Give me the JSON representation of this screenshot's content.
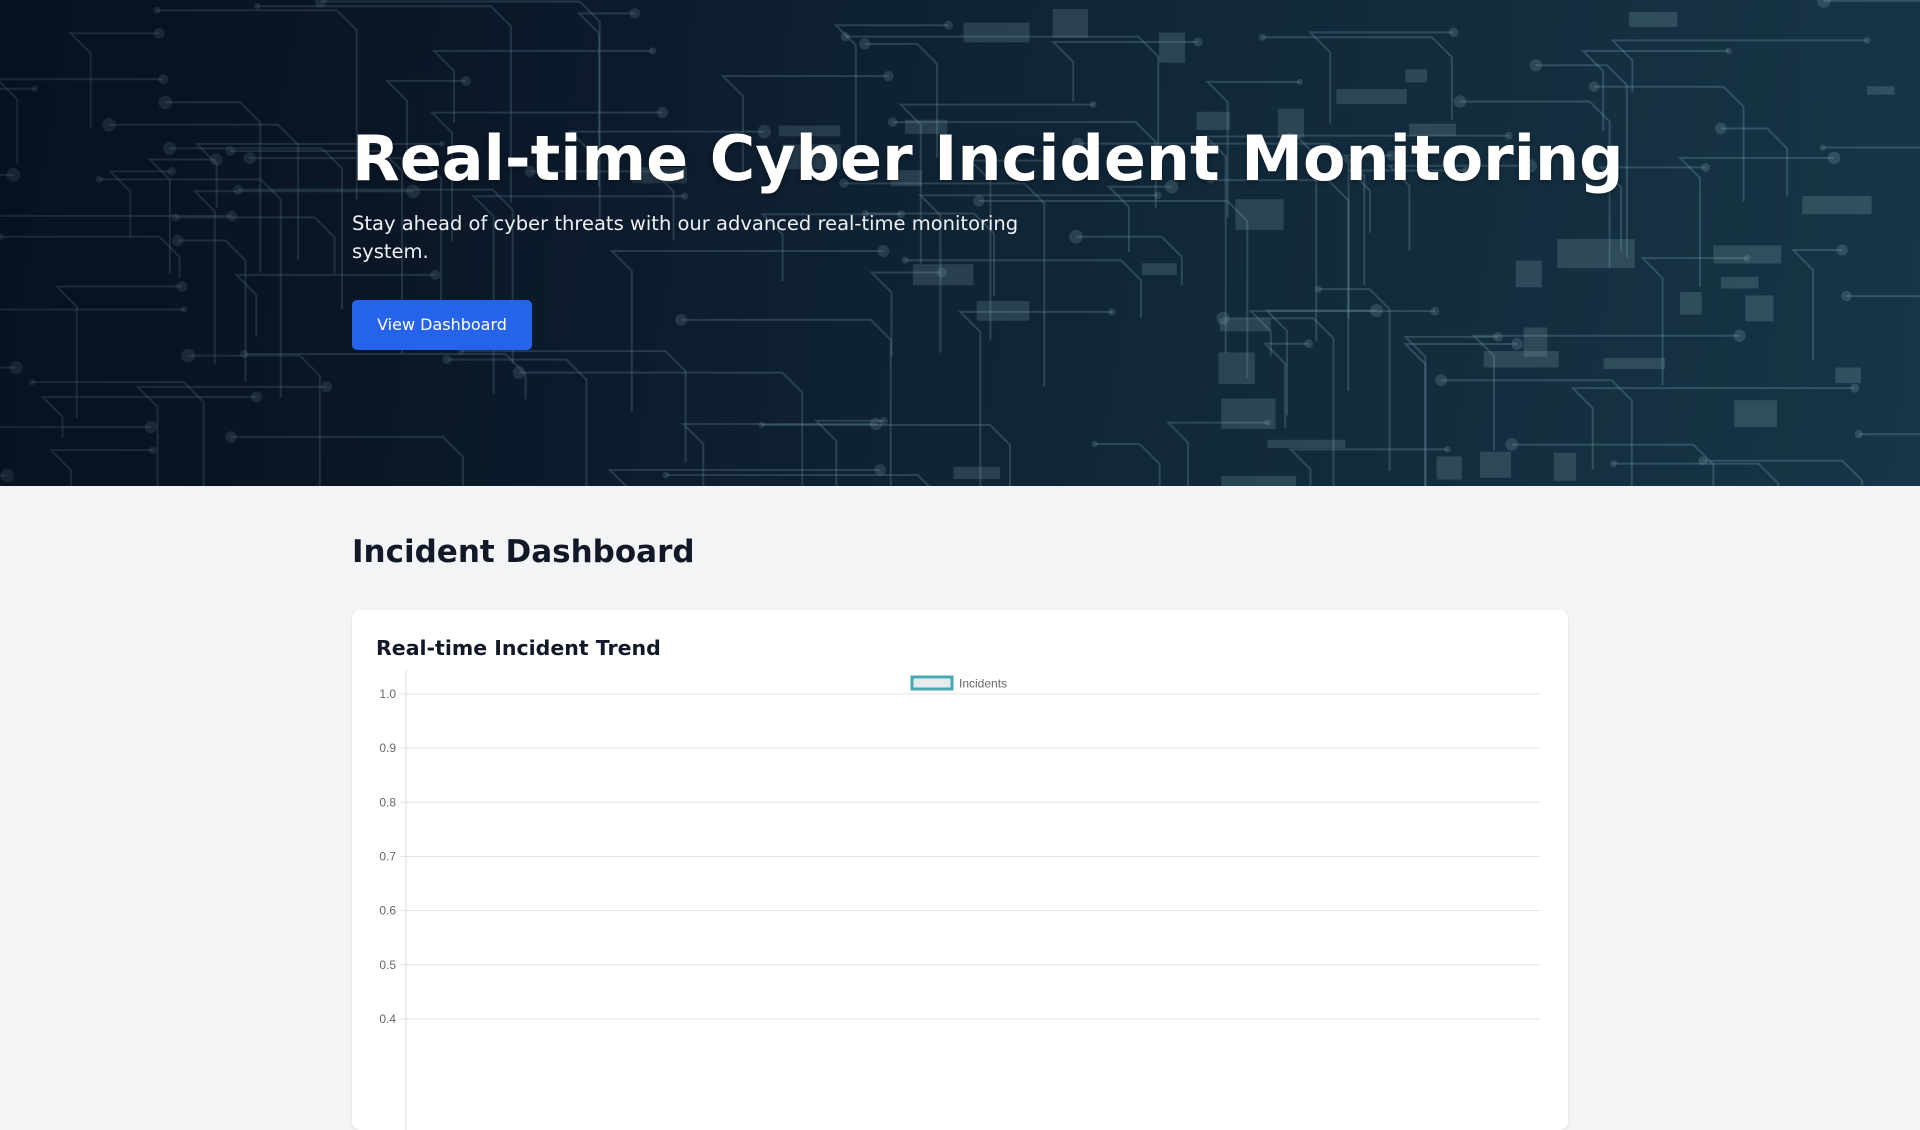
{
  "hero": {
    "title": "Real-time Cyber Incident Monitoring",
    "subtitle": "Stay ahead of cyber threats with our advanced real-time monitoring system.",
    "cta_label": "View Dashboard"
  },
  "dashboard": {
    "title": "Incident Dashboard",
    "chart_card_title": "Real-time Incident Trend"
  },
  "colors": {
    "accent": "#2563eb",
    "series_border": "#4aa8b0",
    "series_fill": "#e6ecee"
  },
  "chart_data": {
    "type": "line",
    "title": "",
    "xlabel": "",
    "ylabel": "",
    "legend_position": "top",
    "grid": true,
    "ylim": [
      0.4,
      1.0
    ],
    "y_ticks": [
      "1.0",
      "0.9",
      "0.8",
      "0.7",
      "0.6",
      "0.5",
      "0.4"
    ],
    "x": [],
    "series": [
      {
        "name": "Incidents",
        "values": []
      }
    ]
  }
}
